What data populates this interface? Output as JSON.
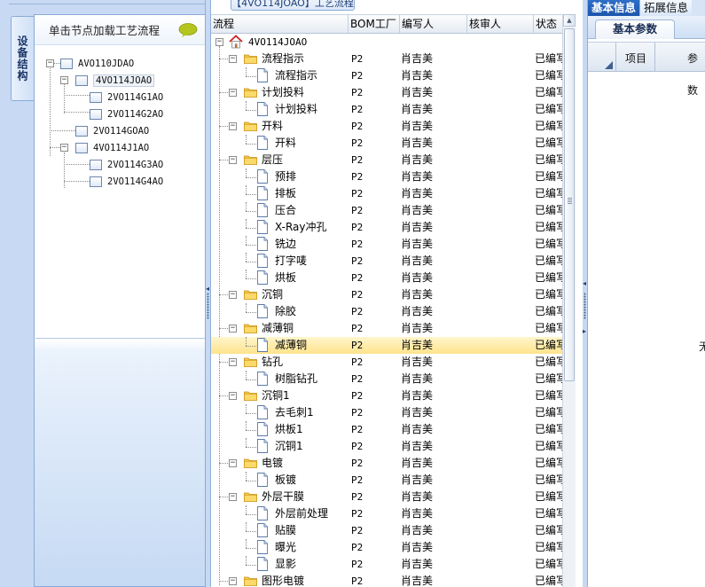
{
  "left": {
    "vertical_tab": "设备结构",
    "header": "单击节点加载工艺流程",
    "tree": [
      {
        "label": "AVO110JDAO"
      },
      {
        "label": "4VO114JOAO"
      },
      {
        "label": "2VO114G1AO"
      },
      {
        "label": "2VO114G2AO"
      },
      {
        "label": "2VO114GOAO"
      },
      {
        "label": "4VO114J1AO"
      },
      {
        "label": "2VO114G3AO"
      },
      {
        "label": "2VO114G4AO"
      }
    ]
  },
  "middle": {
    "title": "【4VO114JOAO】工艺流程",
    "columns": {
      "flow": "流程",
      "bom": "BOM工厂",
      "author": "编写人",
      "reviewer": "核审人",
      "status": "状态"
    },
    "root": {
      "name": "4VO114JOAO"
    },
    "rows": [
      {
        "name": "流程指示",
        "type": "folder",
        "bom": "P2",
        "author": "肖吉美",
        "status": "已编写"
      },
      {
        "name": "流程指示",
        "type": "doc",
        "bom": "P2",
        "author": "肖吉美",
        "status": "已编写"
      },
      {
        "name": "计划投料",
        "type": "folder",
        "bom": "P2",
        "author": "肖吉美",
        "status": "已编写"
      },
      {
        "name": "计划投料",
        "type": "doc",
        "bom": "P2",
        "author": "肖吉美",
        "status": "已编写"
      },
      {
        "name": "开料",
        "type": "folder",
        "bom": "P2",
        "author": "肖吉美",
        "status": "已编写"
      },
      {
        "name": "开料",
        "type": "doc",
        "bom": "P2",
        "author": "肖吉美",
        "status": "已编写"
      },
      {
        "name": "层压",
        "type": "folder",
        "bom": "P2",
        "author": "肖吉美",
        "status": "已编写"
      },
      {
        "name": "预排",
        "type": "doc",
        "bom": "P2",
        "author": "肖吉美",
        "status": "已编写"
      },
      {
        "name": "排板",
        "type": "doc",
        "bom": "P2",
        "author": "肖吉美",
        "status": "已编写"
      },
      {
        "name": "压合",
        "type": "doc",
        "bom": "P2",
        "author": "肖吉美",
        "status": "已编写"
      },
      {
        "name": "X-Ray冲孔",
        "type": "doc",
        "bom": "P2",
        "author": "肖吉美",
        "status": "已编写"
      },
      {
        "name": "铣边",
        "type": "doc",
        "bom": "P2",
        "author": "肖吉美",
        "status": "已编写"
      },
      {
        "name": "打字唛",
        "type": "doc",
        "bom": "P2",
        "author": "肖吉美",
        "status": "已编写"
      },
      {
        "name": "烘板",
        "type": "doc",
        "bom": "P2",
        "author": "肖吉美",
        "status": "已编写"
      },
      {
        "name": "沉铜",
        "type": "folder",
        "bom": "P2",
        "author": "肖吉美",
        "status": "已编写"
      },
      {
        "name": "除胶",
        "type": "doc",
        "bom": "P2",
        "author": "肖吉美",
        "status": "已编写"
      },
      {
        "name": "减薄铜",
        "type": "folder",
        "bom": "P2",
        "author": "肖吉美",
        "status": "已编写"
      },
      {
        "name": "减薄铜",
        "type": "doc",
        "bom": "P2",
        "author": "肖吉美",
        "status": "已编写"
      },
      {
        "name": "钻孔",
        "type": "folder",
        "bom": "P2",
        "author": "肖吉美",
        "status": "已编写"
      },
      {
        "name": "树脂钻孔",
        "type": "doc",
        "bom": "P2",
        "author": "肖吉美",
        "status": "已编写"
      },
      {
        "name": "沉铜1",
        "type": "folder",
        "bom": "P2",
        "author": "肖吉美",
        "status": "已编写"
      },
      {
        "name": "去毛刺1",
        "type": "doc",
        "bom": "P2",
        "author": "肖吉美",
        "status": "已编写"
      },
      {
        "name": "烘板1",
        "type": "doc",
        "bom": "P2",
        "author": "肖吉美",
        "status": "已编写"
      },
      {
        "name": "沉铜1",
        "type": "doc",
        "bom": "P2",
        "author": "肖吉美",
        "status": "已编写"
      },
      {
        "name": "电镀",
        "type": "folder",
        "bom": "P2",
        "author": "肖吉美",
        "status": "已编写"
      },
      {
        "name": "板镀",
        "type": "doc",
        "bom": "P2",
        "author": "肖吉美",
        "status": "已编写"
      },
      {
        "name": "外层干膜",
        "type": "folder",
        "bom": "P2",
        "author": "肖吉美",
        "status": "已编写"
      },
      {
        "name": "外层前处理",
        "type": "doc",
        "bom": "P2",
        "author": "肖吉美",
        "status": "已编写"
      },
      {
        "name": "贴膜",
        "type": "doc",
        "bom": "P2",
        "author": "肖吉美",
        "status": "已编写"
      },
      {
        "name": "曝光",
        "type": "doc",
        "bom": "P2",
        "author": "肖吉美",
        "status": "已编写"
      },
      {
        "name": "显影",
        "type": "doc",
        "bom": "P2",
        "author": "肖吉美",
        "status": "已编写"
      },
      {
        "name": "图形电镀",
        "type": "folder",
        "bom": "P2",
        "author": "肖吉美",
        "status": "已编写"
      }
    ]
  },
  "right": {
    "tabs": [
      "基本信息",
      "拓展信息"
    ],
    "subtab": "基本参数",
    "columns": [
      "项目",
      "参数"
    ],
    "empty_text": "无"
  },
  "colors": {
    "selected_row": "#ffe48c",
    "active_tab": "#1c56ad",
    "panel_bg": "#c8daf3"
  }
}
